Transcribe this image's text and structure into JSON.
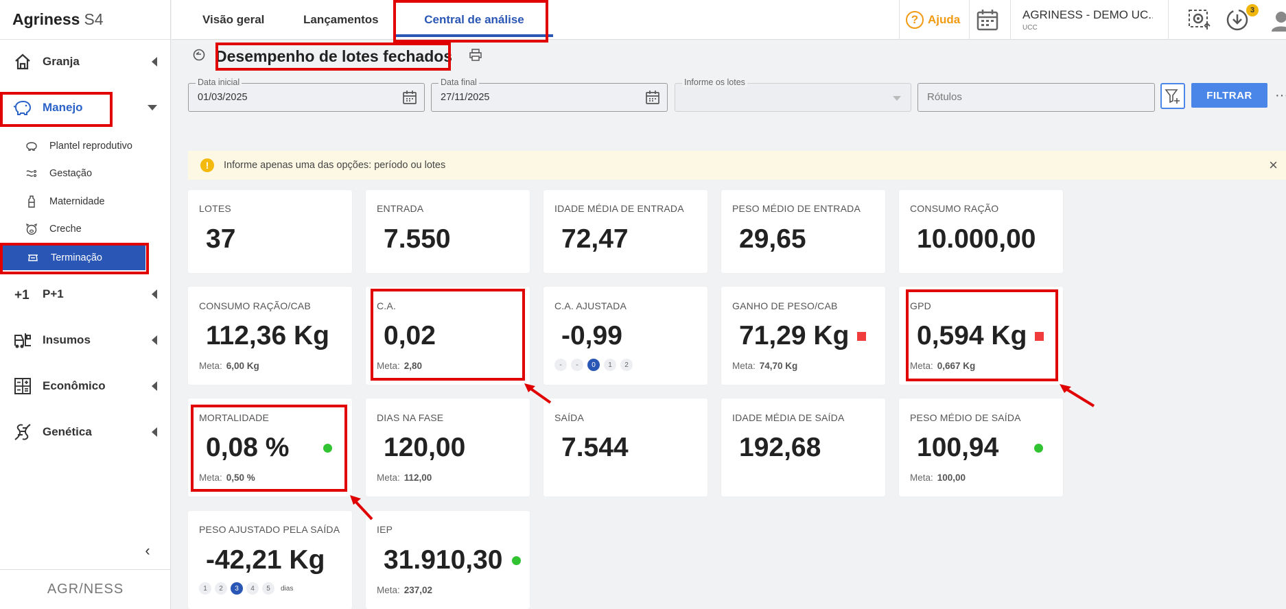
{
  "sidebar": {
    "brand_name": "Agriness",
    "brand_suffix": "S4",
    "items": [
      {
        "label": "Granja",
        "icon": "house-icon"
      },
      {
        "label": "Manejo",
        "icon": "pig-icon"
      },
      {
        "label": "P+1",
        "icon": "plus-one-icon"
      },
      {
        "label": "Insumos",
        "icon": "forklift-icon"
      },
      {
        "label": "Econômico",
        "icon": "calculator-icon"
      },
      {
        "label": "Genética",
        "icon": "dna-icon"
      }
    ],
    "sub_items": [
      {
        "label": "Plantel reprodutivo",
        "icon": "sow-icon"
      },
      {
        "label": "Gestação",
        "icon": "gestation-icon"
      },
      {
        "label": "Maternidade",
        "icon": "bottle-icon"
      },
      {
        "label": "Creche",
        "icon": "piglet-icon"
      },
      {
        "label": "Terminação",
        "icon": "scale-icon"
      }
    ],
    "collapse_glyph": "‹",
    "footer_logo": "AGR/NESS"
  },
  "topbar": {
    "tabs": [
      "Visão geral",
      "Lançamentos",
      "Central de análise"
    ],
    "help_label": "Ajuda",
    "help_glyph": "?",
    "company_name": "AGRINESS - DEMO UC...",
    "company_sub": "UCC",
    "notif_count": "3"
  },
  "page": {
    "title": "Desempenho de lotes fechados"
  },
  "filters": {
    "start_label": "Data inicial",
    "start_value": "01/03/2025",
    "end_label": "Data final",
    "end_value": "27/11/2025",
    "lots_label": "Informe os lotes",
    "tags_placeholder": "Rótulos",
    "filter_button": "FILTRAR",
    "more_glyph": "···"
  },
  "alert": {
    "text": "Informe apenas uma das opções: período ou lotes",
    "icon_glyph": "!",
    "close_glyph": "×"
  },
  "cards": {
    "lotes": {
      "title": "LOTES",
      "value": "37"
    },
    "entrada": {
      "title": "ENTRADA",
      "value": "7.550"
    },
    "idade_entrada": {
      "title": "IDADE MÉDIA DE ENTRADA",
      "value": "72,47"
    },
    "peso_entrada": {
      "title": "PESO MÉDIO DE ENTRADA",
      "value": "29,65"
    },
    "consumo": {
      "title": "CONSUMO RAÇÃO",
      "value": "10.000,00"
    },
    "consumo_cab": {
      "title": "CONSUMO RAÇÃO/CAB",
      "value": "112,36 Kg",
      "meta_label": "Meta:",
      "meta": "6,00 Kg"
    },
    "ca": {
      "title": "C.A.",
      "value": "0,02",
      "meta_label": "Meta:",
      "meta": "2,80"
    },
    "ca_ajustada": {
      "title": "C.A. AJUSTADA",
      "value": "-0,99",
      "pills": [
        "-",
        "-",
        "0",
        "1",
        "2"
      ]
    },
    "ganho_peso": {
      "title": "GANHO DE PESO/CAB",
      "value": "71,29 Kg",
      "meta_label": "Meta:",
      "meta": "74,70 Kg",
      "status_color": "#f03c3c"
    },
    "gpd": {
      "title": "GPD",
      "value": "0,594 Kg",
      "meta_label": "Meta:",
      "meta": "0,667 Kg",
      "status_color": "#f03c3c"
    },
    "mortalidade": {
      "title": "MORTALIDADE",
      "value": "0,08 %",
      "meta_label": "Meta:",
      "meta": "0,50 %",
      "status_color": "#32c332"
    },
    "dias_fase": {
      "title": "DIAS NA FASE",
      "value": "120,00",
      "meta_label": "Meta:",
      "meta": "112,00"
    },
    "saida": {
      "title": "SAÍDA",
      "value": "7.544"
    },
    "idade_saida": {
      "title": "IDADE MÉDIA DE SAÍDA",
      "value": "192,68"
    },
    "peso_saida": {
      "title": "PESO MÉDIO DE SAÍDA",
      "value": "100,94",
      "meta_label": "Meta:",
      "meta": "100,00",
      "status_color": "#32c332"
    },
    "peso_ajustado": {
      "title": "PESO AJUSTADO PELA SAÍDA",
      "value": "-42,21 Kg",
      "pills": [
        "1",
        "2",
        "3",
        "4",
        "5"
      ],
      "pills_suffix": "dias"
    },
    "iep": {
      "title": "IEP",
      "value": "31.910,30",
      "meta_label": "Meta:",
      "meta": "237,02",
      "status_color": "#32c332"
    }
  },
  "colors": {
    "accent": "#2a56b5",
    "button": "#4a85e8",
    "highlight": "#e00000",
    "warning_bg": "#fdf8e4",
    "help": "#f29a12"
  }
}
